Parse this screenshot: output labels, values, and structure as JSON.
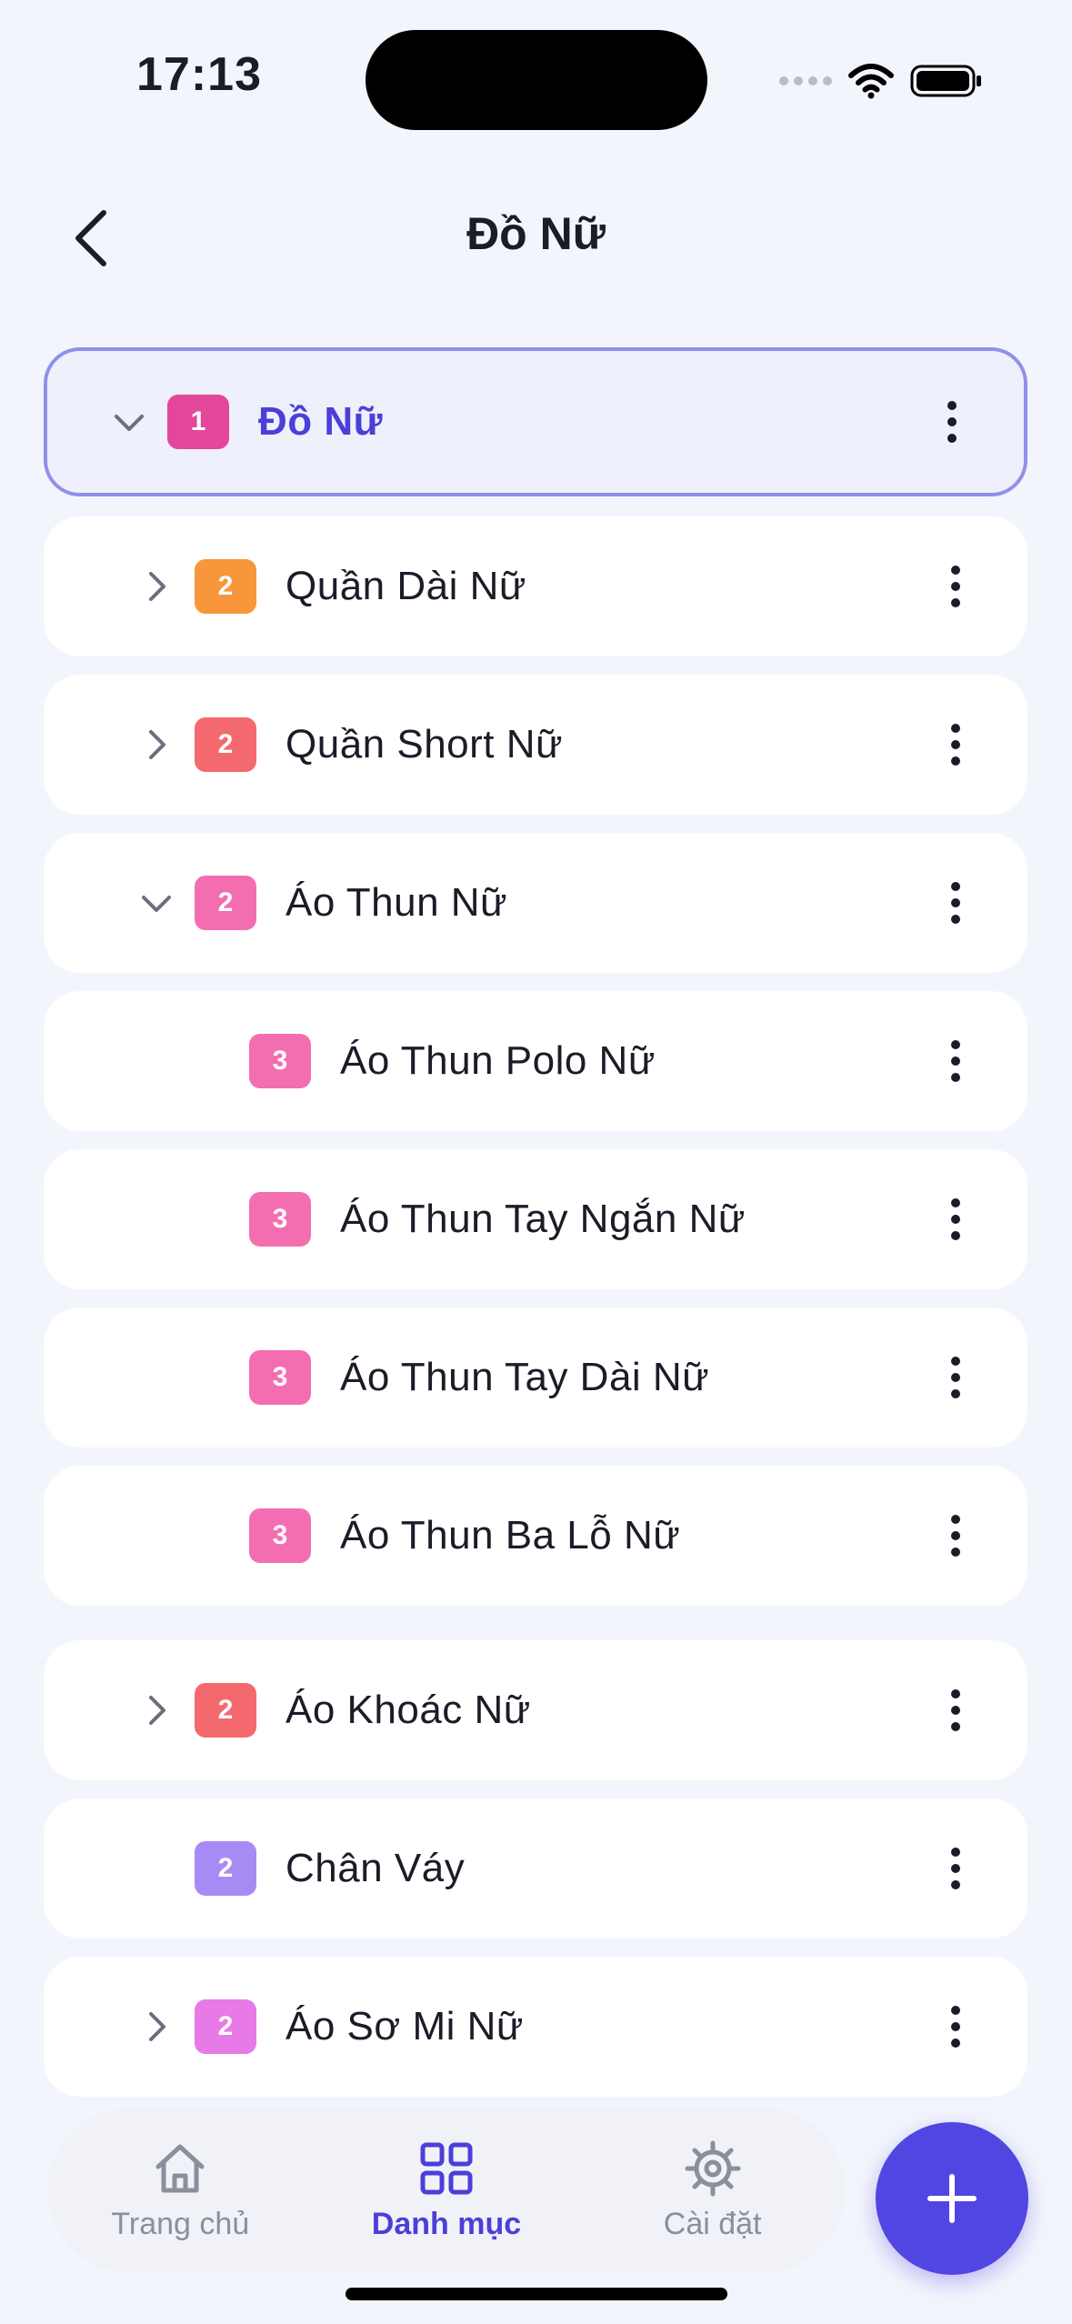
{
  "status_bar": {
    "time": "17:13"
  },
  "header": {
    "title": "Đồ Nữ"
  },
  "rows": [
    {
      "label": "Đồ Nữ",
      "level": "1",
      "badge_color": "#e4479a",
      "chevron": "down",
      "selected": true
    },
    {
      "label": "Quần Dài Nữ",
      "level": "2",
      "badge_color": "#f7963a",
      "chevron": "right"
    },
    {
      "label": "Quần Short Nữ",
      "level": "2",
      "badge_color": "#f4696e",
      "chevron": "right"
    },
    {
      "label": "Áo Thun Nữ",
      "level": "2",
      "badge_color": "#f36eb1",
      "chevron": "down"
    },
    {
      "label": "Áo Thun Polo Nữ",
      "level": "3",
      "badge_color": "#f36eb1",
      "chevron": "none"
    },
    {
      "label": "Áo Thun Tay Ngắn Nữ",
      "level": "3",
      "badge_color": "#f36eb1",
      "chevron": "none"
    },
    {
      "label": "Áo Thun Tay Dài Nữ",
      "level": "3",
      "badge_color": "#f36eb1",
      "chevron": "none"
    },
    {
      "label": "Áo Thun Ba Lỗ Nữ",
      "level": "3",
      "badge_color": "#f36eb1",
      "chevron": "none"
    },
    {
      "label": "Áo Khoác Nữ",
      "level": "2",
      "badge_color": "#f4696e",
      "chevron": "right"
    },
    {
      "label": "Chân Váy",
      "level": "2",
      "badge_color": "#a78bf5",
      "chevron": "none"
    },
    {
      "label": "Áo Sơ Mi Nữ",
      "level": "2",
      "badge_color": "#e77ae6",
      "chevron": "right"
    }
  ],
  "tabs": [
    {
      "label": "Trang chủ",
      "icon": "home-icon",
      "active": false
    },
    {
      "label": "Danh mục",
      "icon": "grid-icon",
      "active": true
    },
    {
      "label": "Cài đặt",
      "icon": "gear-icon",
      "active": false
    }
  ],
  "fab": {
    "icon": "plus-icon"
  },
  "colors": {
    "accent": "#4b3fd9",
    "fab": "#5146e2",
    "background": "#f3f5fc"
  }
}
